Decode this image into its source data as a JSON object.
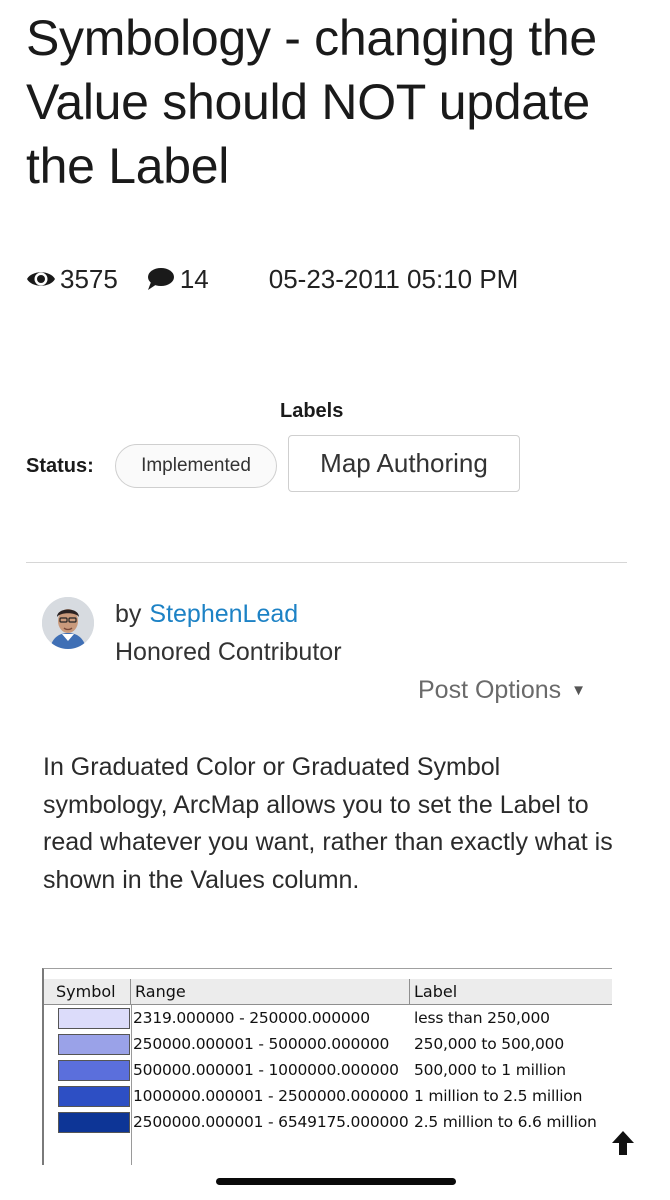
{
  "title": "Symbology - changing the Value should NOT update the Label",
  "stats": {
    "views": "3575",
    "comments": "14",
    "date": "05-23-2011 05:10 PM"
  },
  "labels_heading": "Labels",
  "status": {
    "label": "Status:",
    "value": "Implemented"
  },
  "labels": [
    "Map Authoring"
  ],
  "author": {
    "by": "by",
    "name": "StephenLead",
    "rank": "Honored Contributor"
  },
  "post_options": "Post Options",
  "body": "In Graduated Color or Graduated Symbol symbology, ArcMap allows you to set the Label to read whatever you want, rather than exactly what is shown in the Values column.",
  "symbology_table": {
    "headers": [
      "Symbol",
      "Range",
      "Label"
    ],
    "rows": [
      {
        "color": "#dcdcfa",
        "range": "2319.000000 - 250000.000000",
        "label": "less than 250,000"
      },
      {
        "color": "#9aa2e8",
        "range": "250000.000001 - 500000.000000",
        "label": "250,000 to 500,000"
      },
      {
        "color": "#5b6fdc",
        "range": "500000.000001 - 1000000.000000",
        "label": "500,000 to 1 million"
      },
      {
        "color": "#2d4fc4",
        "range": "1000000.000001 - 2500000.000000",
        "label": "1 million to 2.5 million"
      },
      {
        "color": "#0d3596",
        "range": "2500000.000001 - 6549175.000000",
        "label": "2.5 million to 6.6 million"
      }
    ]
  },
  "icons": {
    "views": "eye-icon",
    "comments": "speech-bubble-icon",
    "post_options_caret": "caret-down-icon",
    "scroll_top": "arrow-up-icon"
  },
  "colors": {
    "link": "#1d82c5",
    "text": "#1c1c1c"
  }
}
